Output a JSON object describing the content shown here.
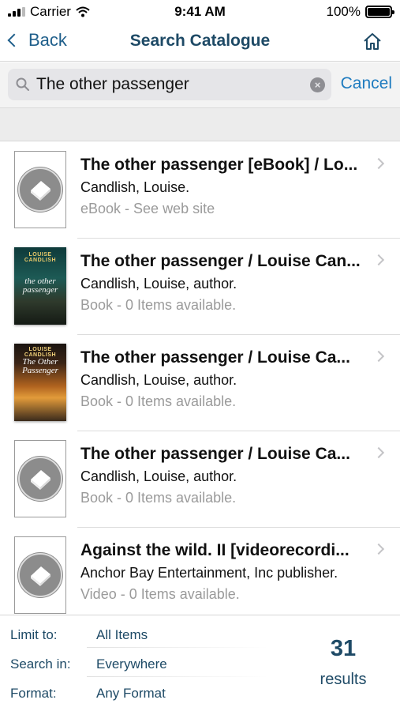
{
  "status_bar": {
    "carrier": "Carrier",
    "time": "9:41 AM",
    "battery": "100%",
    "battery_level": 1.0
  },
  "nav": {
    "back_label": "Back",
    "title": "Search Catalogue",
    "home_icon": "home-icon"
  },
  "search": {
    "value": "The other passenger",
    "cancel_label": "Cancel",
    "search_icon": "magnifier-icon",
    "clear_icon": "clear-x-icon"
  },
  "results": [
    {
      "title": "The other passenger [eBook] / Lo...",
      "author": "Candlish, Louise.",
      "format": "eBook - See web site",
      "thumbnail": "placeholder-book-icon"
    },
    {
      "title": "The other passenger / Louise Can...",
      "author": "Candlish, Louise, author.",
      "format": "Book - 0 Items available.",
      "thumbnail": "book-cover",
      "cover_author": "LOUISE CANDLISH",
      "cover_title": "the other passenger"
    },
    {
      "title": "The other passenger / Louise Ca...",
      "author": "Candlish, Louise, author.",
      "format": "Book - 0 Items available.",
      "thumbnail": "book-cover",
      "cover_author": "LOUISE CANDLISH",
      "cover_title": "The Other Passenger"
    },
    {
      "title": "The other passenger / Louise Ca...",
      "author": "Candlish, Louise, author.",
      "format": "Book - 0 Items available.",
      "thumbnail": "placeholder-book-icon"
    },
    {
      "title": "Against the wild. II [videorecordi...",
      "author": "Anchor Bay Entertainment, Inc publisher.",
      "format": "Video - 0 Items available.",
      "thumbnail": "placeholder-book-icon"
    }
  ],
  "filters": [
    {
      "label": "Limit to:",
      "value": "All Items"
    },
    {
      "label": "Search in:",
      "value": "Everywhere"
    },
    {
      "label": "Format:",
      "value": "Any Format"
    }
  ],
  "summary": {
    "count": "31",
    "label": "results"
  },
  "colors": {
    "accent": "#1e7bbf",
    "title": "#1e4a66",
    "muted": "#9a9a9a"
  }
}
